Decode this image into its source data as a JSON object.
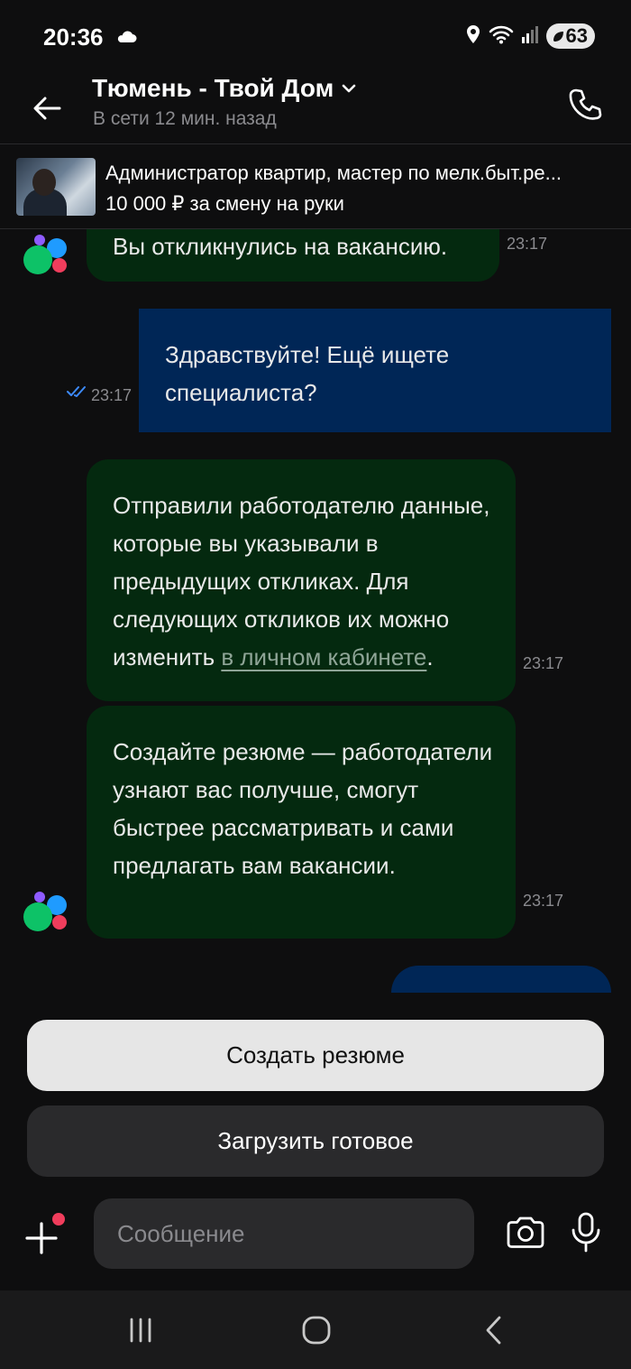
{
  "status_bar": {
    "time": "20:36",
    "battery": "63"
  },
  "header": {
    "title": "Тюмень - Твой Дом",
    "status": "В сети 12 мин. назад"
  },
  "vacancy": {
    "title": "Администратор квартир, мастер по мелк.быт.ре...",
    "salary": "10 000 ₽ за смену на руки"
  },
  "messages": [
    {
      "direction": "in",
      "text": "Вы откликнулись на вакансию.",
      "time": "23:17"
    },
    {
      "direction": "out",
      "text_line1": "Здравствуйте! Ещё ищете",
      "text_line2": "специалиста?",
      "time": "23:17",
      "status": "read"
    },
    {
      "direction": "in",
      "text_before_link": "Отправили работодателю данные, которые вы указывали в предыдущих откликах. Для следующих откликов их можно изменить ",
      "link_text": "в личном кабинете",
      "text_after_link": ".",
      "time": "23:17"
    },
    {
      "direction": "in",
      "text": "Создайте резюме — работодатели узнают вас получше, смогут быстрее рассматривать и сами предлагать вам вакансии.",
      "time": "23:17"
    }
  ],
  "actions": {
    "primary_label": "Создать резюме",
    "secondary_label": "Загрузить готовое"
  },
  "composer": {
    "placeholder": "Сообщение"
  },
  "colors": {
    "incoming_bubble": "#04290f",
    "outgoing_bubble": "#002656",
    "background": "#0e0e0f",
    "read_ticks": "#3d8bff",
    "link": "#8fa597"
  }
}
